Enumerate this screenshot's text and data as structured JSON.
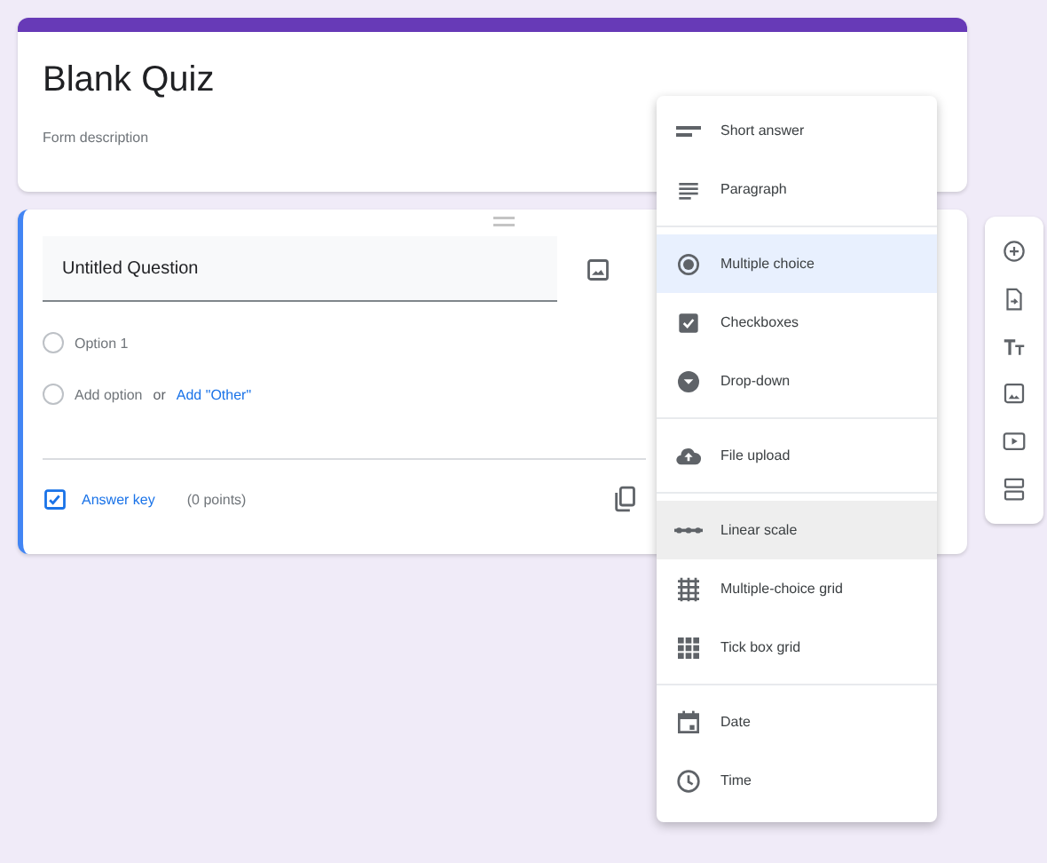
{
  "form": {
    "title": "Blank Quiz",
    "description": "Form description"
  },
  "question": {
    "title": "Untitled Question",
    "options": [
      {
        "label": "Option 1",
        "checked": false
      }
    ],
    "add_option": "Add option",
    "add_option_checked": false,
    "or": "or",
    "add_other": "Add \"Other\"",
    "answer_key": "Answer key",
    "points": "(0 points)"
  },
  "type_menu": {
    "groups": [
      [
        {
          "kind": "short",
          "label": "Short answer",
          "selected": false,
          "highlighted": false
        },
        {
          "kind": "paragraph",
          "label": "Paragraph",
          "selected": false,
          "highlighted": false
        }
      ],
      [
        {
          "kind": "radio",
          "label": "Multiple choice",
          "selected": true,
          "highlighted": false
        },
        {
          "kind": "checkbox",
          "label": "Checkboxes",
          "selected": false,
          "highlighted": false
        },
        {
          "kind": "dropdown",
          "label": "Drop-down",
          "selected": false,
          "highlighted": false
        }
      ],
      [
        {
          "kind": "upload",
          "label": "File upload",
          "selected": false,
          "highlighted": false
        }
      ],
      [
        {
          "kind": "scale",
          "label": "Linear scale",
          "selected": false,
          "highlighted": true
        },
        {
          "kind": "grid",
          "label": "Multiple-choice grid",
          "selected": false,
          "highlighted": false
        },
        {
          "kind": "tickgrid",
          "label": "Tick box grid",
          "selected": false,
          "highlighted": false
        }
      ],
      [
        {
          "kind": "date",
          "label": "Date",
          "selected": false,
          "highlighted": false
        },
        {
          "kind": "time",
          "label": "Time",
          "selected": false,
          "highlighted": false
        }
      ]
    ]
  },
  "side_toolbar": [
    {
      "kind": "add"
    },
    {
      "kind": "import"
    },
    {
      "kind": "title"
    },
    {
      "kind": "image"
    },
    {
      "kind": "video"
    },
    {
      "kind": "section"
    }
  ]
}
